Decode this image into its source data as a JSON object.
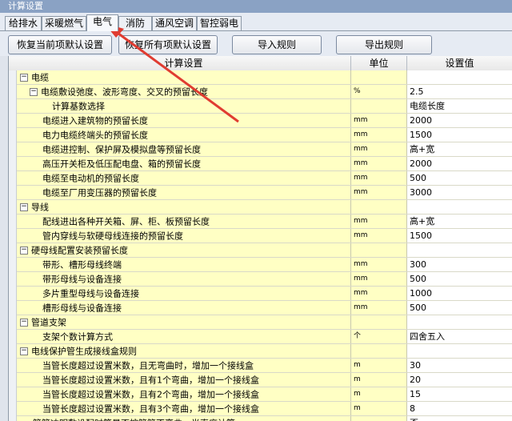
{
  "window": {
    "title": "计算设置"
  },
  "tabs": [
    {
      "label": "给排水",
      "active": false
    },
    {
      "label": "采暖燃气",
      "active": false
    },
    {
      "label": "电气",
      "active": true
    },
    {
      "label": "消防",
      "active": false
    },
    {
      "label": "通风空调",
      "active": false
    },
    {
      "label": "智控弱电",
      "active": false
    }
  ],
  "toolbar": {
    "restore_current": "恢复当前项默认设置",
    "restore_all": "恢复所有项默认设置",
    "import": "导入规则",
    "export": "导出规则"
  },
  "grid": {
    "columns": {
      "name": "计算设置",
      "unit": "单位",
      "value": "设置值"
    },
    "rows": [
      {
        "name": "电缆",
        "unit": "",
        "value": "",
        "level": 0,
        "group": true
      },
      {
        "name": "电缆敷设弛度、波形弯度、交叉的预留长度",
        "unit": "%",
        "value": "2.5",
        "level": 1,
        "group": true
      },
      {
        "name": "计算基数选择",
        "unit": "",
        "value": "电缆长度",
        "level": 2,
        "group": false
      },
      {
        "name": "电缆进入建筑物的预留长度",
        "unit": "mm",
        "value": "2000",
        "level": 1,
        "group": false
      },
      {
        "name": "电力电缆终端头的预留长度",
        "unit": "mm",
        "value": "1500",
        "level": 1,
        "group": false
      },
      {
        "name": "电缆进控制、保护屏及模拟盘等预留长度",
        "unit": "mm",
        "value": "高+宽",
        "level": 1,
        "group": false
      },
      {
        "name": "高压开关柜及低压配电盘、箱的预留长度",
        "unit": "mm",
        "value": "2000",
        "level": 1,
        "group": false
      },
      {
        "name": "电缆至电动机的预留长度",
        "unit": "mm",
        "value": "500",
        "level": 1,
        "group": false
      },
      {
        "name": "电缆至厂用变压器的预留长度",
        "unit": "mm",
        "value": "3000",
        "level": 1,
        "group": false
      },
      {
        "name": "导线",
        "unit": "",
        "value": "",
        "level": 0,
        "group": true
      },
      {
        "name": "配线进出各种开关箱、屏、柜、板预留长度",
        "unit": "mm",
        "value": "高+宽",
        "level": 1,
        "group": false
      },
      {
        "name": "管内穿线与软硬母线连接的预留长度",
        "unit": "mm",
        "value": "1500",
        "level": 1,
        "group": false
      },
      {
        "name": "硬母线配置安装预留长度",
        "unit": "",
        "value": "",
        "level": 0,
        "group": true
      },
      {
        "name": "带形、槽形母线终端",
        "unit": "mm",
        "value": "300",
        "level": 1,
        "group": false
      },
      {
        "name": "带形母线与设备连接",
        "unit": "mm",
        "value": "500",
        "level": 1,
        "group": false
      },
      {
        "name": "多片重型母线与设备连接",
        "unit": "mm",
        "value": "1000",
        "level": 1,
        "group": false
      },
      {
        "name": "槽形母线与设备连接",
        "unit": "mm",
        "value": "500",
        "level": 1,
        "group": false
      },
      {
        "name": "管道支架",
        "unit": "",
        "value": "",
        "level": 0,
        "group": true
      },
      {
        "name": "支架个数计算方式",
        "unit": "个",
        "value": "四舍五入",
        "level": 1,
        "group": false
      },
      {
        "name": "电线保护管生成接线盒规则",
        "unit": "",
        "value": "",
        "level": 0,
        "group": true
      },
      {
        "name": "当管长度超过设置米数，且无弯曲时，增加一个接线盒",
        "unit": "m",
        "value": "30",
        "level": 1,
        "group": false
      },
      {
        "name": "当管长度超过设置米数，且有1个弯曲，增加一个接线盒",
        "unit": "m",
        "value": "20",
        "level": 1,
        "group": false
      },
      {
        "name": "当管长度超过设置米数，且有2个弯曲，增加一个接线盒",
        "unit": "m",
        "value": "15",
        "level": 1,
        "group": false
      },
      {
        "name": "当管长度超过设置米数，且有3个弯曲，增加一个接线盒",
        "unit": "m",
        "value": "8",
        "level": 1,
        "group": false
      },
      {
        "name": "管管冲明敷设配时符是否按管管不弯曲，半直度计算",
        "unit": "",
        "value": "否",
        "level": 0,
        "group": false
      }
    ]
  },
  "annotation": {
    "arrow_color": "#e03c31"
  }
}
